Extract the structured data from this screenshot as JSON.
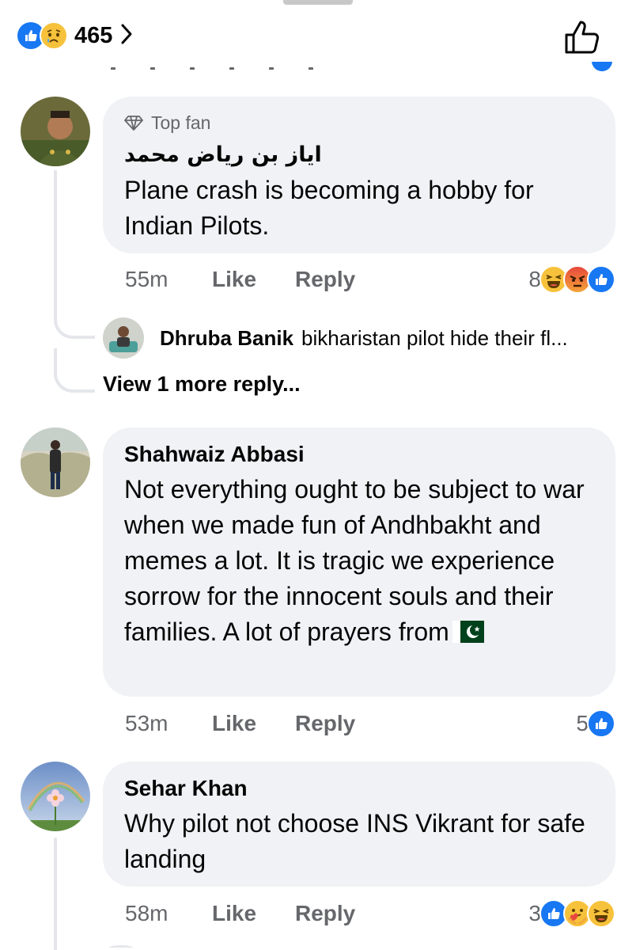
{
  "header": {
    "reaction_count": "465",
    "reaction_icons": [
      "like-icon",
      "sad-icon"
    ],
    "like_icon": "thumbs-up-outline-icon"
  },
  "colors": {
    "like_blue": "#1877f2",
    "haha_yellow": "#f7c23b",
    "angry_red": "#e9710f",
    "bubble": "#f0f2f5",
    "meta_gray": "#65676b"
  },
  "comments": [
    {
      "badge": "Top fan",
      "author": "اياز بن رياض محمد",
      "text": "Plane crash is becoming a hobby for Indian Pilots.",
      "time": "55m",
      "like_label": "Like",
      "reply_label": "Reply",
      "reaction_count": "8",
      "reactions": [
        "haha-icon",
        "angry-icon",
        "like-icon"
      ],
      "replies": {
        "preview_author": "Dhruba Banik",
        "preview_text": "bikharistan pilot hide their fl...",
        "more_label": "View 1 more reply..."
      }
    },
    {
      "author": "Shahwaiz Abbasi",
      "text": "Not everything ought to be subject to war when we made fun of Andhbakht and memes a lot. It is tragic we experience sorrow for the innocent souls and their families. A lot of prayers from",
      "flag": "pakistan-flag-icon",
      "time": "53m",
      "like_label": "Like",
      "reply_label": "Reply",
      "reaction_count": "5",
      "reactions": [
        "like-icon"
      ]
    },
    {
      "author": "Sehar Khan",
      "text": "Why pilot not choose INS Vikrant for safe landing",
      "time": "58m",
      "like_label": "Like",
      "reply_label": "Reply",
      "reaction_count": "3",
      "reactions": [
        "like-icon",
        "care-icon",
        "haha-icon"
      ]
    }
  ]
}
